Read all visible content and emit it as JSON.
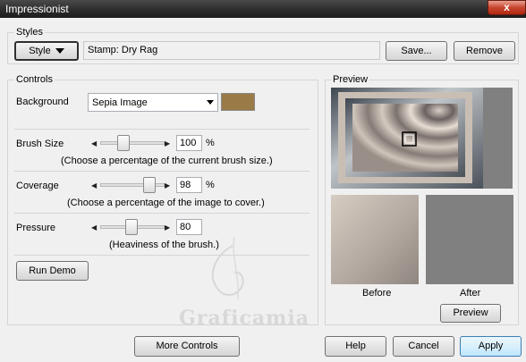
{
  "window": {
    "title": "Impressionist",
    "close_glyph": "x"
  },
  "styles": {
    "group_label": "Styles",
    "style_button": "Style",
    "current_style": "Stamp: Dry Rag",
    "save_button": "Save...",
    "remove_button": "Remove"
  },
  "controls": {
    "group_label": "Controls",
    "background": {
      "label": "Background",
      "value": "Sepia Image",
      "swatch_color": "#9a7a46"
    },
    "brush_size": {
      "label": "Brush Size",
      "value": "100",
      "unit": "%",
      "level": 0.33,
      "hint": "(Choose a percentage of the current brush size.)"
    },
    "coverage": {
      "label": "Coverage",
      "value": "98",
      "unit": "%",
      "level": 0.82,
      "hint": "(Choose a percentage of the image to cover.)"
    },
    "pressure": {
      "label": "Pressure",
      "value": "80",
      "level": 0.48,
      "hint": "(Heaviness of the brush.)"
    },
    "run_demo_button": "Run Demo"
  },
  "preview": {
    "group_label": "Preview",
    "before_label": "Before",
    "after_label": "After",
    "preview_button": "Preview"
  },
  "watermark": "Graficamia",
  "footer": {
    "more_controls_button": "More Controls",
    "help_button": "Help",
    "cancel_button": "Cancel",
    "apply_button": "Apply"
  }
}
